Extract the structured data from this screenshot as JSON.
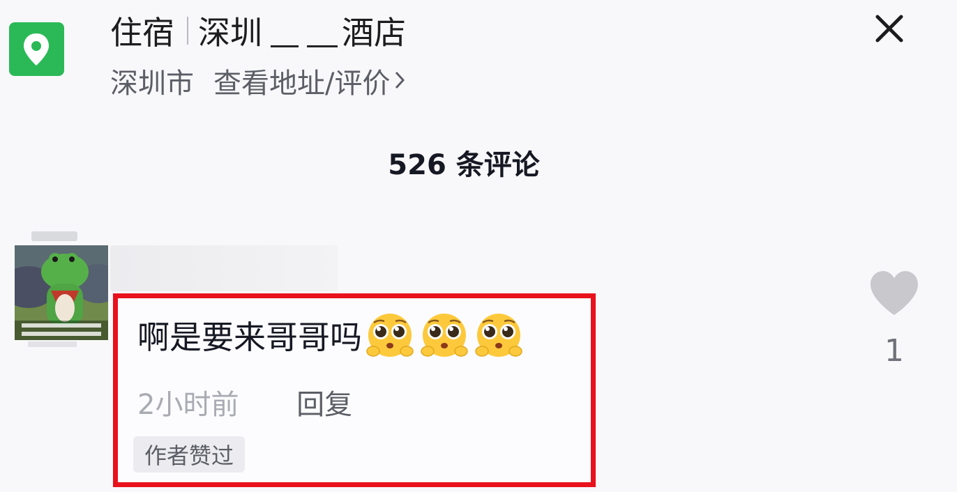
{
  "header": {
    "category": "住宿",
    "hotel_name_start": "深圳",
    "hotel_name_end": "酒店",
    "city": "深圳市",
    "address_link": "查看地址/评价",
    "close_icon": "close-icon",
    "location_icon": "map-pin-icon"
  },
  "comments_header": {
    "count_label": "526 条评论"
  },
  "comment": {
    "text": "啊是要来哥哥吗",
    "emojis": [
      "pleading-face-icon",
      "pleading-face-icon",
      "pleading-face-icon"
    ],
    "time": "2小时前",
    "reply_label": "回复",
    "badge": "作者赞过",
    "like_count": "1",
    "like_icon": "heart-icon",
    "avatar": "avatar-green-dinosaur"
  },
  "colors": {
    "location_green": "#2bb957",
    "highlight_red": "#e8111c",
    "muted_text": "#a9abb2",
    "heart_gray": "#c8c8cd"
  }
}
